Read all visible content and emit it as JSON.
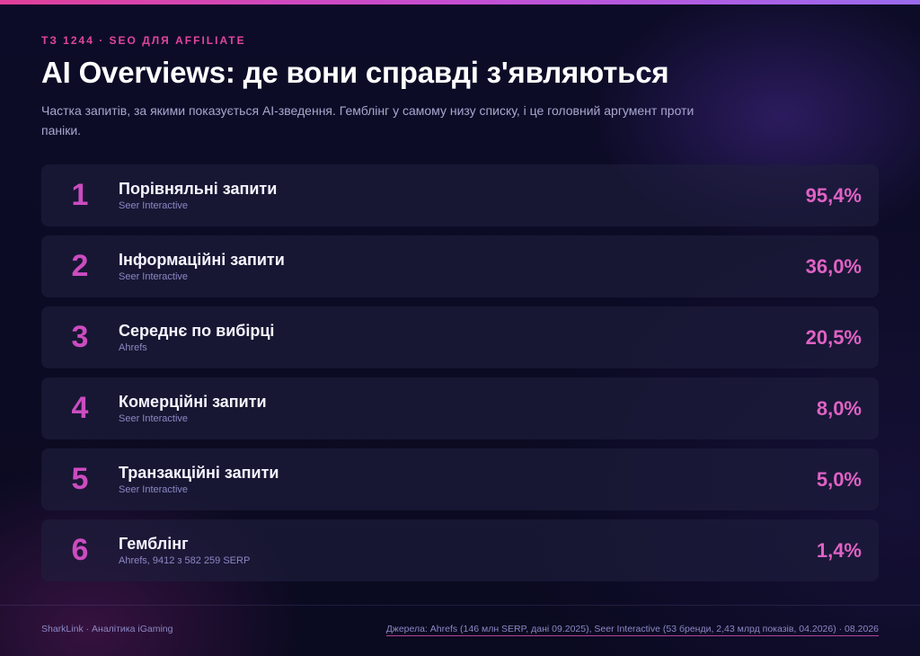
{
  "header": {
    "eyebrow": "ТЗ 1244 · SEO ДЛЯ AFFILIATE",
    "title": "AI Overviews: де вони справді з'являються",
    "subtitle": "Частка запитів, за якими показується AI-зведення. Гемблінг у самому низу списку, і це головний аргумент проти паніки."
  },
  "rows": [
    {
      "rank": "1",
      "label": "Порівняльні запити",
      "source": "Seer Interactive",
      "value": "95,4%"
    },
    {
      "rank": "2",
      "label": "Інформаційні запити",
      "source": "Seer Interactive",
      "value": "36,0%"
    },
    {
      "rank": "3",
      "label": "Середнє по вибірці",
      "source": "Ahrefs",
      "value": "20,5%"
    },
    {
      "rank": "4",
      "label": "Комерційні запити",
      "source": "Seer Interactive",
      "value": "8,0%"
    },
    {
      "rank": "5",
      "label": "Транзакційні запити",
      "source": "Seer Interactive",
      "value": "5,0%"
    },
    {
      "rank": "6",
      "label": "Гемблінг",
      "source": "Ahrefs, 9412 з 582 259 SERP",
      "value": "1,4%"
    }
  ],
  "footer": {
    "left": "SharkLink · Аналітика iGaming",
    "right": "Джерела: Ahrefs (146 млн SERP, дані 09.2025), Seer Interactive (53 бренди, 2,43 млрд показів, 04.2026) · 08.2026"
  },
  "colors": {
    "accent": "#e0459e",
    "value": "#e062c4",
    "rank": "#cc4cc0",
    "background": "#0b0b22"
  }
}
